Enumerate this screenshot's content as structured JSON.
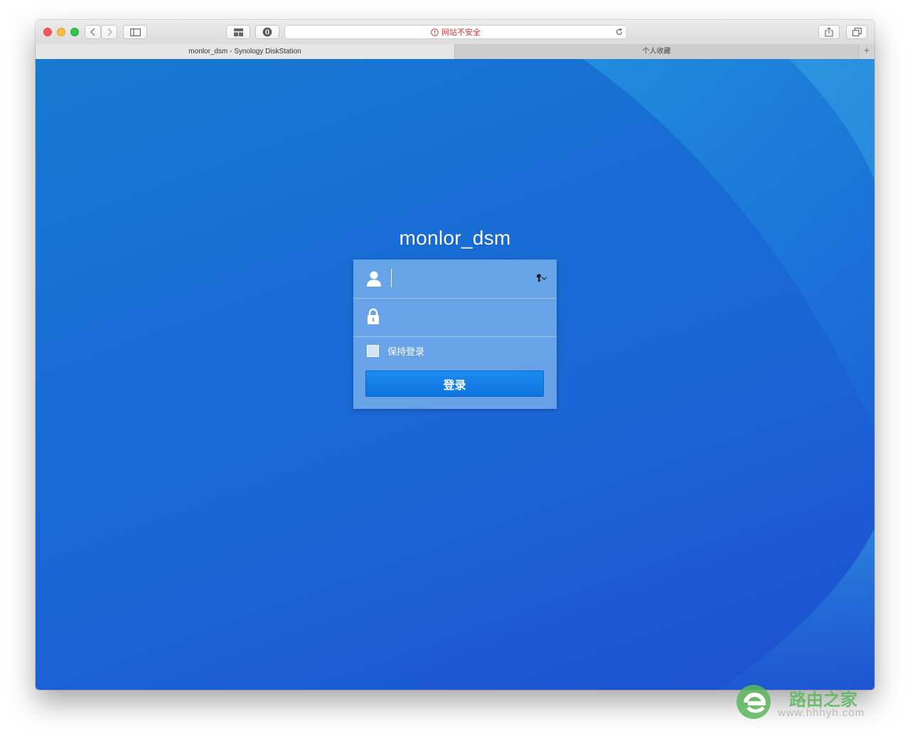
{
  "browser": {
    "url_warning": "网站不安全",
    "tabs": [
      {
        "label": "monlor_dsm - Synology DiskStation",
        "active": true
      },
      {
        "label": "个人收藏",
        "active": false
      }
    ],
    "new_tab_label": "+"
  },
  "login": {
    "hostname": "monlor_dsm",
    "username": {
      "value": "",
      "placeholder": ""
    },
    "password": {
      "value": "",
      "placeholder": ""
    },
    "remember_label": "保持登录",
    "remember_checked": false,
    "submit_label": "登录"
  },
  "watermark": {
    "brand": "路由之家",
    "site": "www.hhhyh.com"
  },
  "icons": {
    "user": "user-icon",
    "lock": "lock-icon",
    "key": "key-icon",
    "warning": "warning-icon",
    "reload": "reload-icon"
  },
  "colors": {
    "background_blue": "#186dd4",
    "button_blue": "#1482e8",
    "warning_red": "#e2332b",
    "watermark_green": "#5cb85c"
  }
}
